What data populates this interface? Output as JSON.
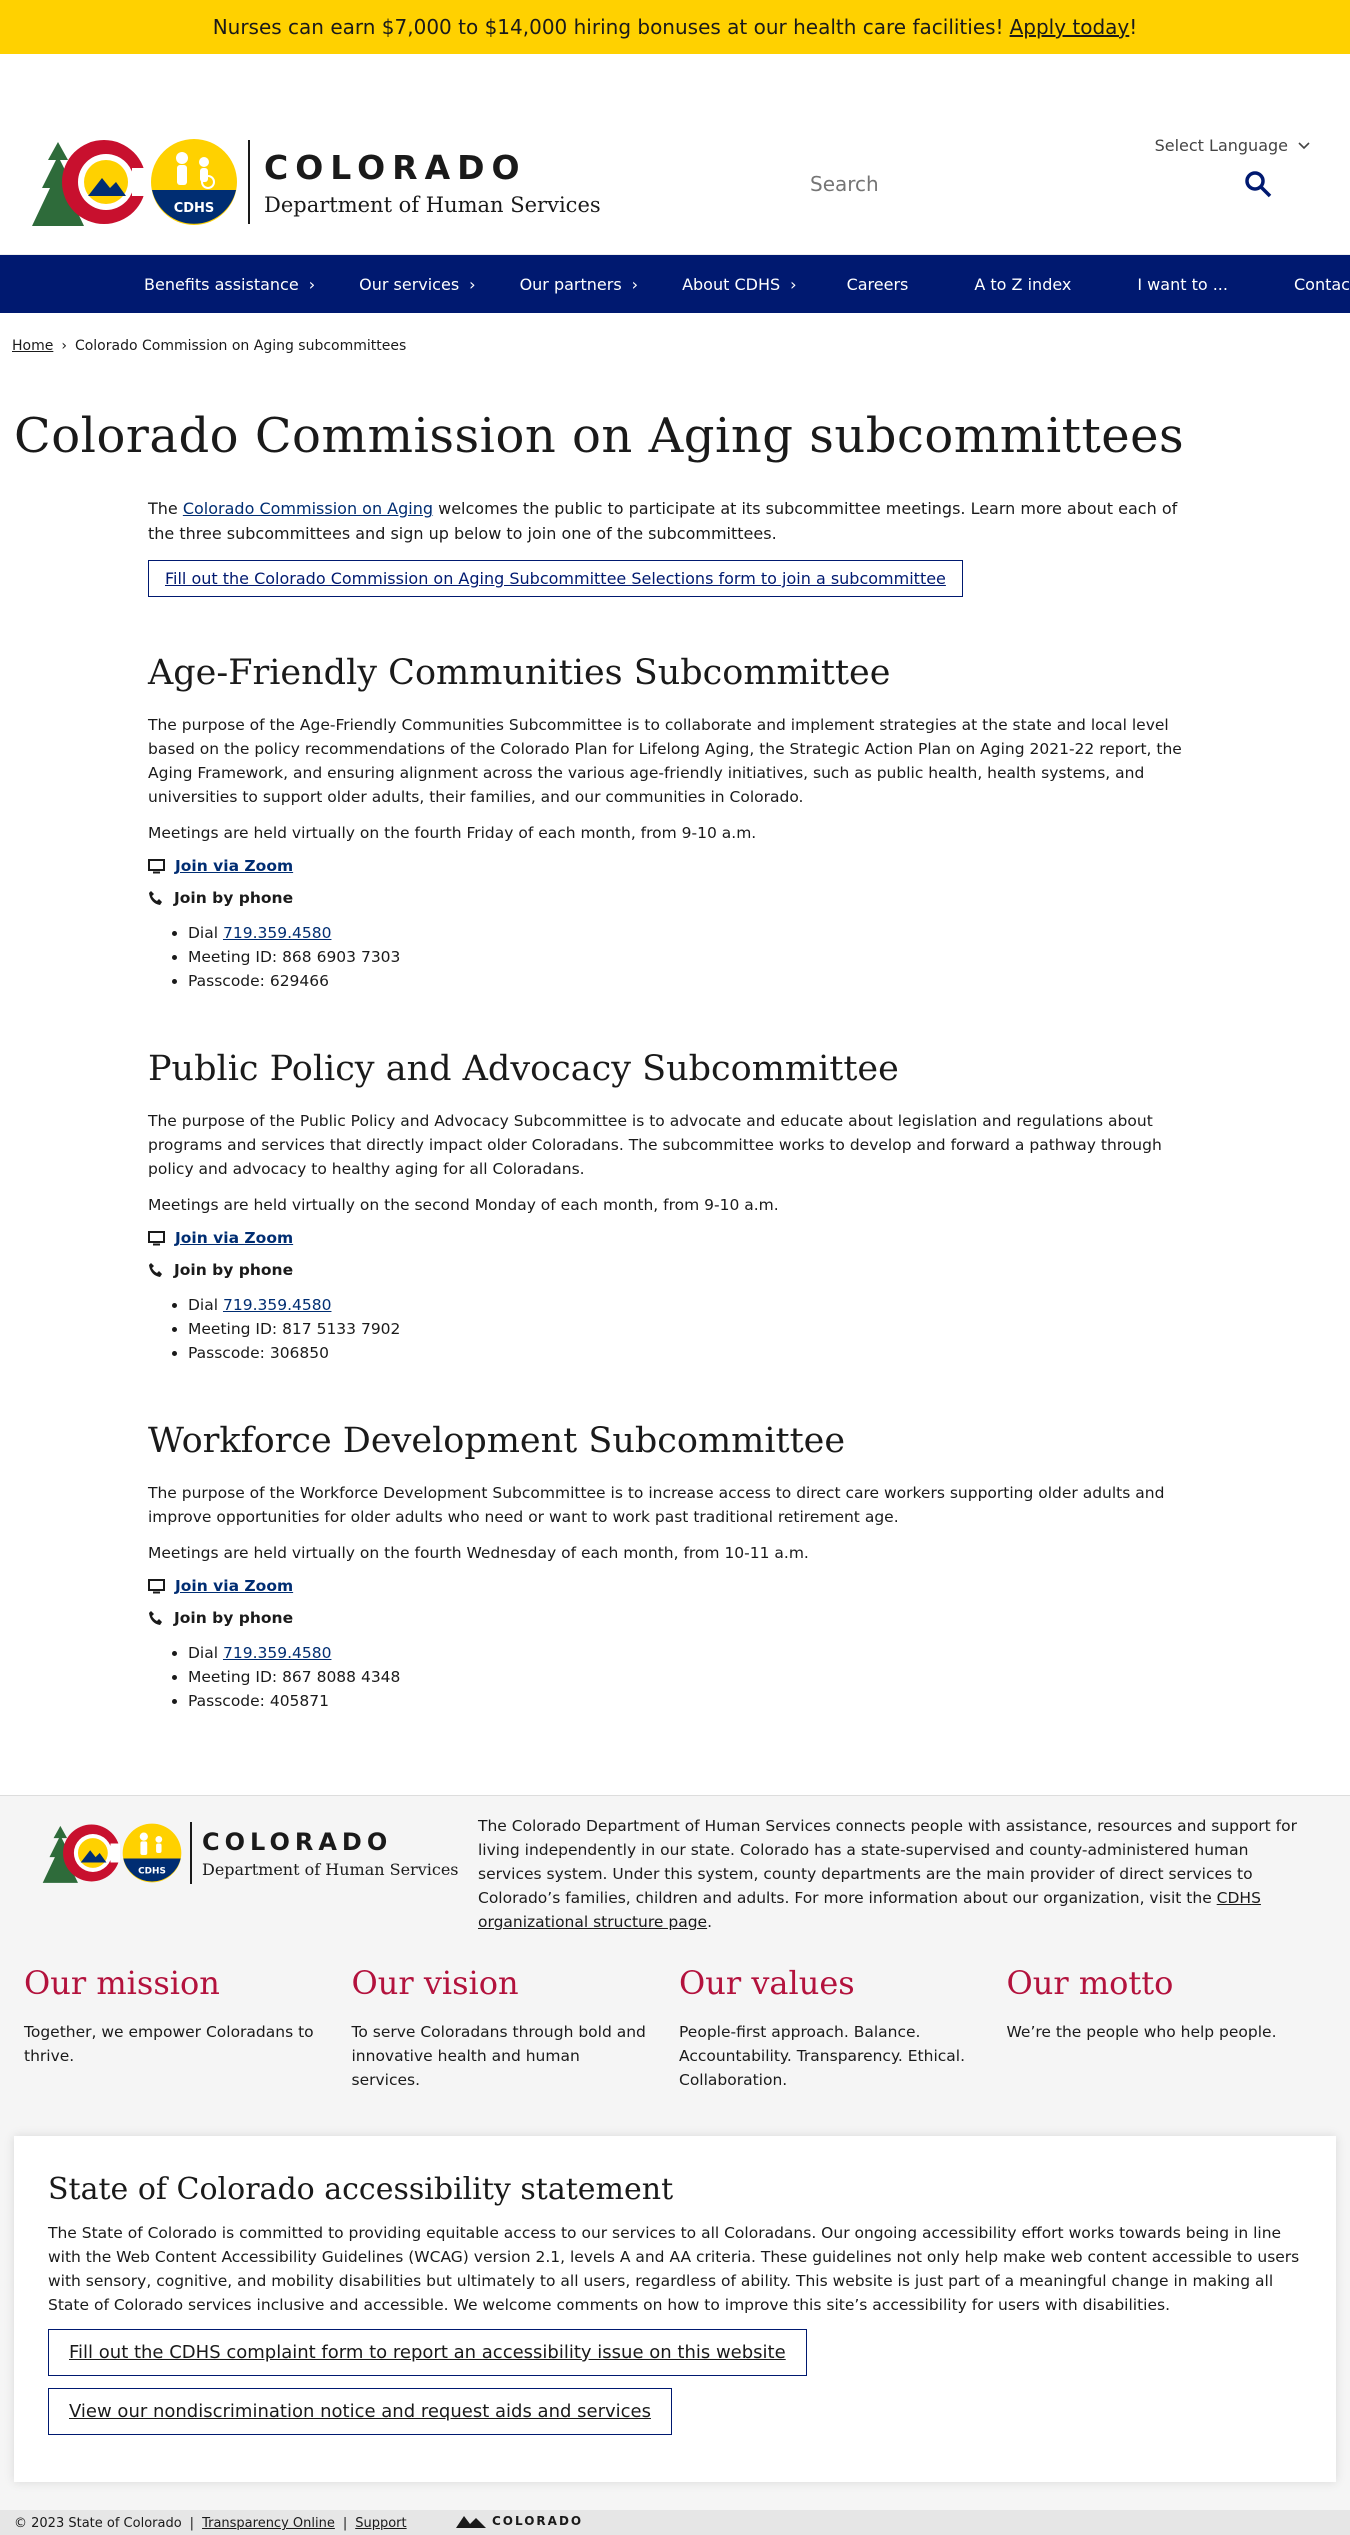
{
  "banner": {
    "text": "Nurses can earn $7,000 to $14,000 hiring bonuses at our health care facilities!",
    "link": "Apply today",
    "suffix": "!"
  },
  "language": {
    "label": "Select Language"
  },
  "logo": {
    "name": "COLORADO",
    "department": "Department of Human Services",
    "badge": "CDHS"
  },
  "search": {
    "placeholder": "Search"
  },
  "nav": {
    "items": [
      {
        "label": "Benefits assistance",
        "chevron": true
      },
      {
        "label": "Our services",
        "chevron": true
      },
      {
        "label": "Our partners",
        "chevron": true
      },
      {
        "label": "About CDHS",
        "chevron": true
      },
      {
        "label": "Careers"
      },
      {
        "label": "A to Z index"
      },
      {
        "label": "I want to ..."
      },
      {
        "label": "Contact us"
      }
    ]
  },
  "breadcrumb": {
    "home": "Home",
    "sep": "›",
    "current": "Colorado Commission on Aging subcommittees"
  },
  "page": {
    "title": "Colorado Commission on Aging subcommittees",
    "intro_pre": "The ",
    "intro_link": "Colorado Commission on Aging",
    "intro_post": " welcomes the public to participate at its subcommittee meetings. Learn more about each of the three subcommittees and sign up below to join one of the subcommittees.",
    "form_button": "Fill out the Colorado Commission on Aging Subcommittee Selections form to join a subcommittee"
  },
  "sections": [
    {
      "title": "Age-Friendly Communities Subcommittee",
      "purpose": "The purpose of the Age-Friendly Communities Subcommittee is to collaborate and implement strategies at the state and local level based on the policy recommendations of the Colorado Plan for Lifelong Aging, the Strategic Action Plan on Aging 2021-22 report, the Aging Framework, and ensuring alignment across the various age-friendly initiatives, such as public health, health systems, and universities to support older adults, their families, and our communities in Colorado.",
      "meetings": "Meetings are held virtually on the fourth Friday of each month, from 9-10 a.m.",
      "zoom": "Join via Zoom",
      "phone": "Join by phone",
      "dial_label": "Dial ",
      "dial": "719.359.4580",
      "meeting_id": "Meeting ID: 868 6903 7303",
      "passcode": "Passcode: 629466"
    },
    {
      "title": "Public Policy and Advocacy Subcommittee",
      "purpose": "The purpose of the Public Policy and Advocacy Subcommittee is to advocate and educate about legislation and regulations about programs and services that directly impact older Coloradans. The subcommittee works to develop and forward a pathway through policy and advocacy to healthy aging for all Coloradans.",
      "meetings": "Meetings are held virtually on the second Monday of each month, from 9-10 a.m.",
      "zoom": "Join via Zoom",
      "phone": "Join by phone",
      "dial_label": "Dial ",
      "dial": "719.359.4580",
      "meeting_id": "Meeting ID: 817 5133 7902",
      "passcode": "Passcode: 306850"
    },
    {
      "title": "Workforce Development Subcommittee",
      "purpose": "The purpose of the Workforce Development Subcommittee is to increase access to direct care workers supporting older adults and improve opportunities for older adults who need or want to work past traditional retirement age.",
      "meetings": "Meetings are held virtually on the fourth Wednesday of each month, from 10-11 a.m.",
      "zoom": "Join via Zoom",
      "phone": "Join by phone",
      "dial_label": "Dial ",
      "dial": "719.359.4580",
      "meeting_id": "Meeting ID: 867 8088 4348",
      "passcode": "Passcode: 405871"
    }
  ],
  "footer": {
    "about_pre": "The Colorado Department of Human Services connects people with assistance, resources and support for living independently in our state. Colorado has a state-supervised and county-administered human services system. Under this system, county departments are the main provider of direct services to Colorado’s families, children and adults. For more information about our organization, visit the ",
    "about_link": "CDHS organizational structure page",
    "about_post": ".",
    "pillars": [
      {
        "title": "Our mission",
        "text": "Together, we empower Coloradans to thrive."
      },
      {
        "title": "Our vision",
        "text": "To serve Coloradans through bold and innovative health and human services."
      },
      {
        "title": "Our values",
        "text": "People-first approach. Balance. Accountability. Transparency. Ethical. Collaboration."
      },
      {
        "title": "Our motto",
        "text": "We’re the people who help people."
      }
    ],
    "accessibility": {
      "title": "State of Colorado accessibility statement",
      "text": "The State of Colorado is committed to providing equitable access to our services to all Coloradans. Our ongoing accessibility effort works towards being in line with the Web Content Accessibility Guidelines (WCAG) version 2.1, levels A and AA criteria. These guidelines not only help make web content accessible to users with sensory, cognitive, and mobility disabilities but ultimately to all users, regardless of ability. This website is just part of a meaningful change in making all State of Colorado services inclusive and accessible. We welcome comments on how to improve this site’s accessibility for users with disabilities.",
      "button1": "Fill out the CDHS complaint form to report an accessibility issue on this website",
      "button2": "View our nondiscrimination notice and request aids and services"
    },
    "bottom": {
      "copyright": "© 2023 State of Colorado",
      "sep": "|",
      "transparency": "Transparency Online",
      "support": "Support",
      "brand": "COLORADO"
    }
  },
  "colors": {
    "banner": "#ffd100",
    "nav": "#001970",
    "pillar_title": "#b3123d",
    "link": "#002d72"
  }
}
